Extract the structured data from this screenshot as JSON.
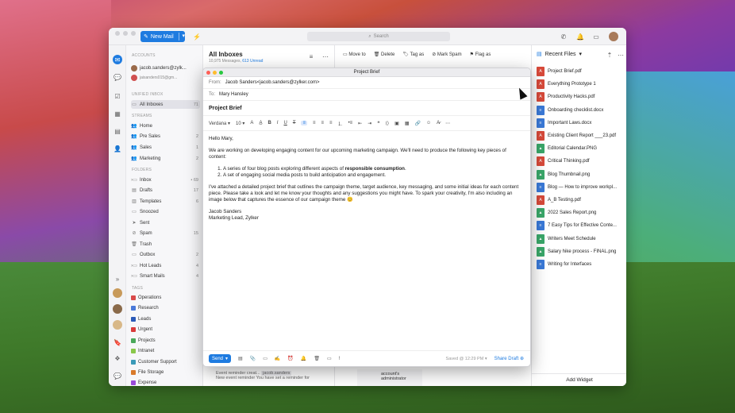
{
  "app": {
    "new_mail": "New Mail",
    "search_placeholder": "Search"
  },
  "sidebar": {
    "accounts_label": "ACCOUNTS",
    "accounts": [
      "jacob.sanders@zylk...",
      "jaisanders015@gm..."
    ],
    "unified_label": "UNIFIED INBOX",
    "all_inboxes": {
      "label": "All Inboxes",
      "count": "71"
    },
    "streams_label": "STREAMS",
    "streams": [
      {
        "label": "Home",
        "count": ""
      },
      {
        "label": "Pre Sales",
        "count": "2"
      },
      {
        "label": "Sales",
        "count": "1"
      },
      {
        "label": "Marketing",
        "count": "2"
      }
    ],
    "folders_label": "FOLDERS",
    "folders": [
      {
        "label": "Inbox",
        "count": "• 69"
      },
      {
        "label": "Drafts",
        "count": "17"
      },
      {
        "label": "Templates",
        "count": "6"
      },
      {
        "label": "Snoozed",
        "count": ""
      },
      {
        "label": "Sent",
        "count": ""
      },
      {
        "label": "Spam",
        "count": "15"
      },
      {
        "label": "Trash",
        "count": ""
      },
      {
        "label": "Outbox",
        "count": "2"
      },
      {
        "label": "Hot Leads",
        "count": "4"
      },
      {
        "label": "Smart Mails",
        "count": "4"
      }
    ],
    "tags_label": "TAGS",
    "tags": [
      {
        "label": "Operations",
        "color": "#d94a4a"
      },
      {
        "label": "Research",
        "color": "#4a7ad9"
      },
      {
        "label": "Leads",
        "color": "#2a5ab8"
      },
      {
        "label": "Urgent",
        "color": "#d93a3a"
      },
      {
        "label": "Projects",
        "color": "#4aa85a"
      },
      {
        "label": "Intranet",
        "color": "#8ac84a"
      },
      {
        "label": "Customer Support",
        "color": "#3a9ab8"
      },
      {
        "label": "File Storage",
        "color": "#d97a2a"
      },
      {
        "label": "Expense",
        "color": "#9a4ad9"
      }
    ]
  },
  "list": {
    "title": "All Inboxes",
    "messages": "10,975 Messages,",
    "unread": "613 Unread"
  },
  "toolbar": {
    "move_to": "Move to",
    "delete": "Delete",
    "tag_as": "Tag as",
    "mark_spam": "Mark Spam",
    "flag_as": "Flag as"
  },
  "recent": {
    "title": "Recent Files",
    "files": [
      {
        "name": "Project Brief.pdf",
        "type": "pdf"
      },
      {
        "name": "Everything Prototype 1",
        "type": "pdf"
      },
      {
        "name": "Productivity Hacks.pdf",
        "type": "pdf"
      },
      {
        "name": "Onboarding checklist.docx",
        "type": "doc"
      },
      {
        "name": "Important Laws.docx",
        "type": "doc"
      },
      {
        "name": "Existing Client Report ___23.pdf",
        "type": "pdf"
      },
      {
        "name": "Editorial Calendar.PNG",
        "type": "img"
      },
      {
        "name": "Critical Thinking.pdf",
        "type": "pdf"
      },
      {
        "name": "Blog Thumbnail.png",
        "type": "img"
      },
      {
        "name": "Blog — How to improve workpl...",
        "type": "doc"
      },
      {
        "name": "A_B Testing.pdf",
        "type": "pdf"
      },
      {
        "name": "2022 Sales Report.png",
        "type": "img"
      },
      {
        "name": "7 Easy Tips for Effective Conte...",
        "type": "doc"
      },
      {
        "name": "Writers Meet Schedule",
        "type": "img"
      },
      {
        "name": "Salary hike process - FINAL.png",
        "type": "img"
      },
      {
        "name": "Writing for Interfaces",
        "type": "doc"
      }
    ],
    "add_widget": "Add Widget"
  },
  "compose": {
    "window_title": "Project Brief",
    "from_label": "From:",
    "from": "Jacob Sanders<jacob.sanders@zylker.com>",
    "to_label": "To:",
    "to": "Mary Hansley",
    "subject": "Project Brief",
    "font": "Verdana",
    "size": "10",
    "greeting": "Hello Mary,",
    "p1": "We are working on developing engaging content for our upcoming marketing campaign. We'll need to produce the following key pieces of content:",
    "li1_pre": "A series of four blog posts exploring different aspects of ",
    "li1_bold": "responsible consumption",
    "li1_post": ".",
    "li2": "A set of engaging social media posts to build anticipation and engagement.",
    "p2": "I've attached a detailed project brief that outlines the campaign theme, target audience, key messaging, and some initial ideas for each content piece. Please take a look and let me know your thoughts and any suggestions you might have. To spark your creativity, I'm also including an image below that captures the essence of our campaign theme 😊",
    "sig_name": "Jacob Sanders",
    "sig_title": "Marketing Lead, Zylker",
    "send": "Send",
    "saved": "Saved @ 12:29 PM",
    "share_draft": "Share Draft"
  },
  "behind": {
    "reminder_title": "Event reminder creat...",
    "reminder_tag": "jacob.sanders",
    "reminder_body": "New event reminder You have set a reminder for",
    "admin_text": "account's administrator"
  }
}
